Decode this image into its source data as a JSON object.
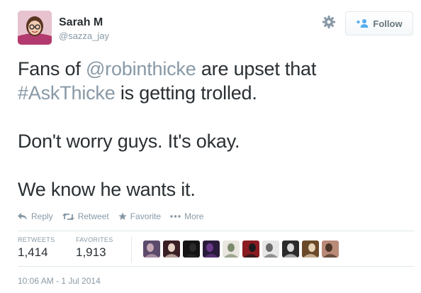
{
  "user": {
    "name": "Sarah M",
    "handle": "@sazza_jay"
  },
  "follow_button": {
    "label": "Follow"
  },
  "tweet": {
    "line1_pre": "Fans of ",
    "mention": "@robinthicke",
    "line1_post": " are upset that",
    "hashtag": "#AskThicke",
    "line2_post": " is getting trolled.",
    "line3": "Don't worry guys. It's okay.",
    "line4": "We know he wants it."
  },
  "actions": {
    "reply": "Reply",
    "retweet": "Retweet",
    "favorite": "Favorite",
    "more": "More"
  },
  "stats": {
    "retweets_label": "RETWEETS",
    "retweets_value": "1,414",
    "favorites_label": "FAVORITES",
    "favorites_value": "1,913"
  },
  "favoriter_avatars": [
    {
      "colors": [
        "#5b4a6b",
        "#c7a9b5"
      ]
    },
    {
      "colors": [
        "#3a1f25",
        "#e8d3c6"
      ]
    },
    {
      "colors": [
        "#141414",
        "#2a2a2a"
      ]
    },
    {
      "colors": [
        "#2a1b3a",
        "#6a3b8a"
      ]
    },
    {
      "colors": [
        "#e8e6df",
        "#7b8a6a"
      ]
    },
    {
      "colors": [
        "#8a1c22",
        "#1b1b1b"
      ]
    },
    {
      "colors": [
        "#e6e6e6",
        "#6b6b6b"
      ]
    },
    {
      "colors": [
        "#2b2b2b",
        "#d9d9d9"
      ]
    },
    {
      "colors": [
        "#6b4a2a",
        "#e6d3b8"
      ]
    },
    {
      "colors": [
        "#b98a78",
        "#4a3428"
      ]
    }
  ],
  "timestamp": "10:06 AM - 1 Jul 2014",
  "colors": {
    "text": "#292f33",
    "muted": "#8899a6",
    "link_blue": "#55acee",
    "border": "#e1e8ed"
  }
}
